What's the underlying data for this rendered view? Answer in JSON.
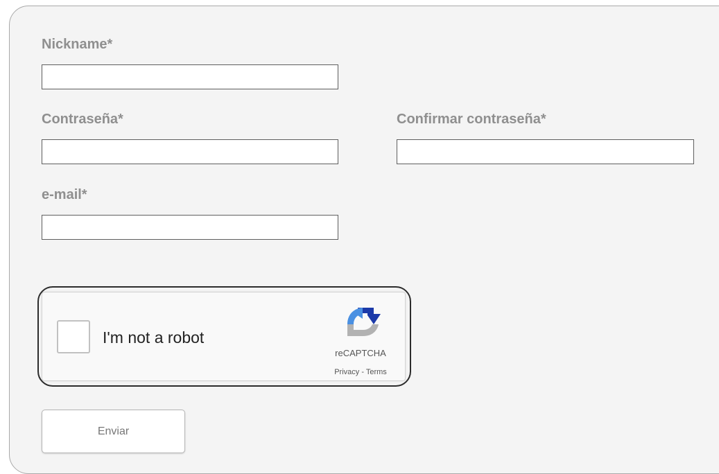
{
  "form": {
    "nickname": {
      "label": "Nickname*",
      "value": "",
      "placeholder": ""
    },
    "password": {
      "label": "Contraseña*",
      "value": "",
      "placeholder": ""
    },
    "confirm_password": {
      "label": "Confirmar contraseña*",
      "value": "",
      "placeholder": ""
    },
    "email": {
      "label": "e-mail*",
      "value": "",
      "placeholder": ""
    }
  },
  "recaptcha": {
    "checkbox_label": "I'm not a robot",
    "checked": false,
    "brand": "reCAPTCHA",
    "privacy_link": "Privacy",
    "separator": " - ",
    "terms_link": "Terms",
    "logo_icon": "recaptcha-logo",
    "colors": {
      "blue_light": "#4a90e2",
      "blue_dark": "#1c3aa9",
      "gray": "#b2b2b2"
    }
  },
  "submit": {
    "label": "Enviar"
  },
  "colors": {
    "panel_background": "#f4f4f4",
    "label_text": "#8f8f8f",
    "field_border": "#5e5e5e"
  }
}
